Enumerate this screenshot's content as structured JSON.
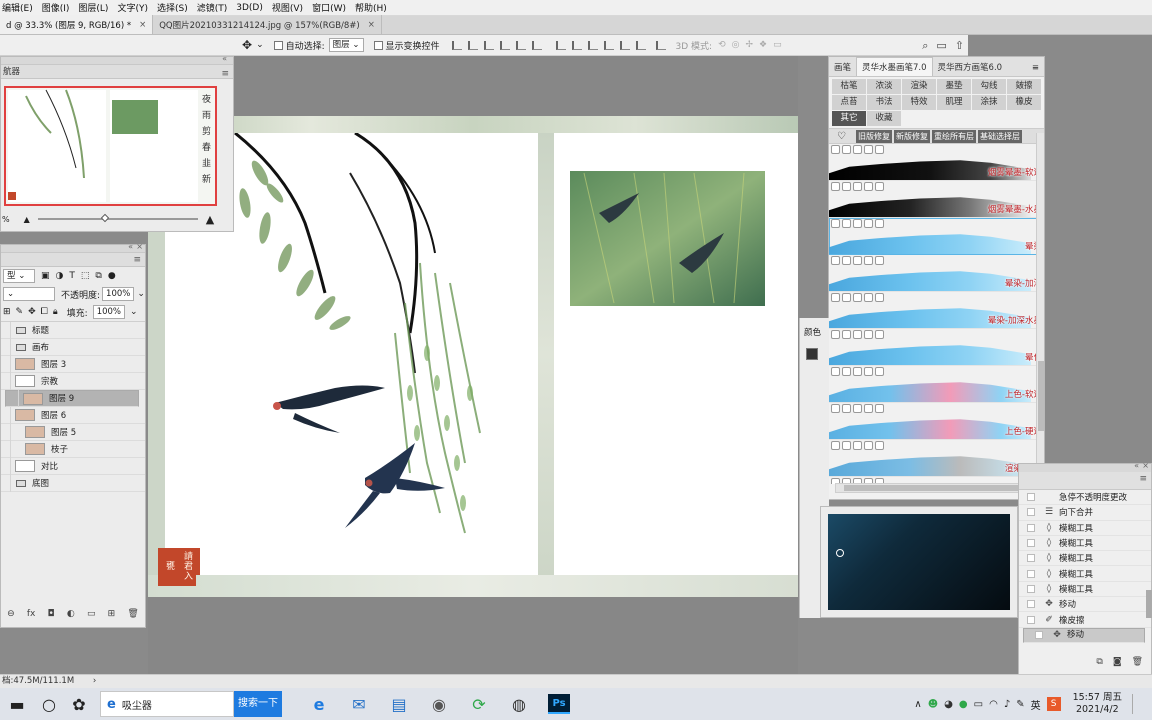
{
  "menu": [
    "编辑(E)",
    "图像(I)",
    "图层(L)",
    "文字(Y)",
    "选择(S)",
    "滤镜(T)",
    "3D(D)",
    "视图(V)",
    "窗口(W)",
    "帮助(H)"
  ],
  "doc_tabs": [
    {
      "label": "d @ 33.3% (图层 9, RGB/16) *",
      "active": true
    },
    {
      "label": "QQ图片20210331214124.jpg @ 157%(RGB/8#)",
      "active": false
    }
  ],
  "options": {
    "auto_select_label": "自动选择:",
    "auto_select_value": "图层",
    "show_transform_label": "显示变换控件",
    "mode_3d_label": "3D 模式:"
  },
  "navigator": {
    "title": "航器",
    "zoom": "%"
  },
  "layers_panel": {
    "kind_value": "型",
    "opacity_label": "不透明度:",
    "opacity_value": "100%",
    "fill_label": "填充:",
    "fill_value": "100%",
    "layers": [
      {
        "name": "标题",
        "type": "folder",
        "selected": false
      },
      {
        "name": "画布",
        "type": "folder",
        "selected": false
      },
      {
        "name": "图层 3",
        "type": "layer",
        "selected": false
      },
      {
        "name": "宗教",
        "type": "layer",
        "selected": false
      },
      {
        "name": "图层 9",
        "type": "layer",
        "selected": true
      },
      {
        "name": "图层 6",
        "type": "layer",
        "selected": false
      },
      {
        "name": "图层 5",
        "type": "layer",
        "selected": false
      },
      {
        "name": "枝子",
        "type": "layer",
        "selected": false
      },
      {
        "name": "对比",
        "type": "layer",
        "selected": false
      },
      {
        "name": "底图",
        "type": "folder",
        "selected": false
      }
    ]
  },
  "brushes": {
    "tabs": [
      {
        "label": "画笔",
        "active": false
      },
      {
        "label": "灵华水墨画笔7.0",
        "active": true
      },
      {
        "label": "灵华西方画笔6.0",
        "active": false
      }
    ],
    "categories": [
      {
        "label": "枯笔",
        "active": false
      },
      {
        "label": "浓淡",
        "active": false
      },
      {
        "label": "渲染",
        "active": false
      },
      {
        "label": "墨垫",
        "active": false
      },
      {
        "label": "勾线",
        "active": false
      },
      {
        "label": "皴擦",
        "active": false
      },
      {
        "label": "点苔",
        "active": false
      },
      {
        "label": "书法",
        "active": false
      },
      {
        "label": "特效",
        "active": false
      },
      {
        "label": "肌理",
        "active": false
      },
      {
        "label": "涂抹",
        "active": false
      },
      {
        "label": "橡皮",
        "active": false
      },
      {
        "label": "其它",
        "active": true
      },
      {
        "label": "收藏",
        "active": false
      }
    ],
    "actions": [
      "旧版修复",
      "新版修复",
      "重绘所有层",
      "基础选择层"
    ],
    "items": [
      {
        "name": "烟雾晕墨-软边",
        "style": "black",
        "selected": false
      },
      {
        "name": "烟雾晕墨-水墨",
        "style": "black2",
        "selected": false
      },
      {
        "name": "晕染",
        "style": "blue",
        "selected": true
      },
      {
        "name": "晕染-加深",
        "style": "blue",
        "selected": false
      },
      {
        "name": "晕染-加深水墨",
        "style": "blue",
        "selected": false
      },
      {
        "name": "晕化",
        "style": "blue",
        "selected": false
      },
      {
        "name": "上色-软边",
        "style": "pink",
        "selected": false
      },
      {
        "name": "上色-硬边",
        "style": "pink",
        "selected": false
      },
      {
        "name": "渲染-上色",
        "style": "grey",
        "selected": false
      },
      {
        "name": "渲染-加色",
        "style": "blue",
        "selected": false
      }
    ]
  },
  "color_panel": {
    "label": "颜色"
  },
  "history": {
    "items": [
      {
        "icon": "blank",
        "label": "急停不透明度更改",
        "selected": false
      },
      {
        "icon": "merge",
        "label": "向下合并",
        "selected": false
      },
      {
        "icon": "blur",
        "label": "模糊工具",
        "selected": false
      },
      {
        "icon": "blur",
        "label": "模糊工具",
        "selected": false
      },
      {
        "icon": "blur",
        "label": "模糊工具",
        "selected": false
      },
      {
        "icon": "blur",
        "label": "模糊工具",
        "selected": false
      },
      {
        "icon": "blur",
        "label": "模糊工具",
        "selected": false
      },
      {
        "icon": "move",
        "label": "移动",
        "selected": false
      },
      {
        "icon": "eraser",
        "label": "橡皮擦",
        "selected": false
      },
      {
        "icon": "move",
        "label": "移动",
        "selected": true
      }
    ]
  },
  "status": "档:47.5M/111.1M",
  "taskbar": {
    "app_label": "吸尘器",
    "search_button": "搜索一下",
    "ime": "英",
    "time": "15:57 周五",
    "date": "2021/4/2"
  },
  "seal_text": "請君入甕",
  "colors": {
    "accent_selection": "#5ab5e6",
    "brush_label": "#c0252a",
    "seal": "#c2472a",
    "ps_blue": "#31a8ff"
  }
}
